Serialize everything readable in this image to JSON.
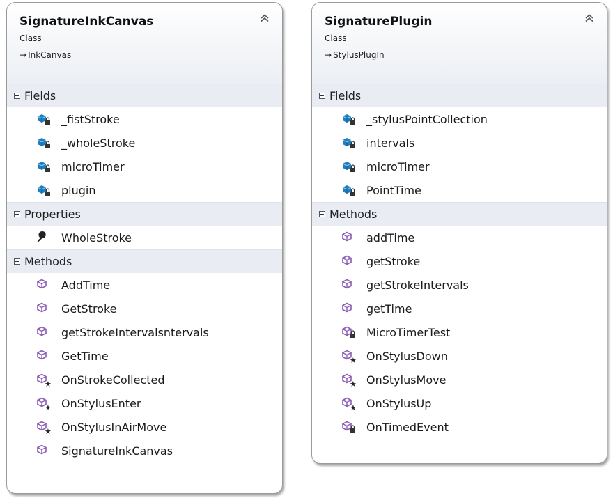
{
  "diagram": {
    "classes": [
      {
        "name": "SignatureInkCanvas",
        "stereotype": "Class",
        "base": "InkCanvas",
        "sections": [
          {
            "title": "Fields",
            "members": [
              {
                "name": "_fistStroke",
                "icon": "private-field-icon"
              },
              {
                "name": "_wholeStroke",
                "icon": "private-field-icon"
              },
              {
                "name": "microTimer",
                "icon": "private-field-icon"
              },
              {
                "name": "plugin",
                "icon": "private-field-icon"
              }
            ]
          },
          {
            "title": "Properties",
            "members": [
              {
                "name": "WholeStroke",
                "icon": "property-wrench-icon"
              }
            ]
          },
          {
            "title": "Methods",
            "members": [
              {
                "name": "AddTime",
                "icon": "public-method-icon"
              },
              {
                "name": "GetStroke",
                "icon": "public-method-icon"
              },
              {
                "name": "getStrokeIntervalsntervals",
                "icon": "public-method-icon"
              },
              {
                "name": "GetTime",
                "icon": "public-method-icon"
              },
              {
                "name": "OnStrokeCollected",
                "icon": "protected-method-icon"
              },
              {
                "name": "OnStylusEnter",
                "icon": "protected-method-icon"
              },
              {
                "name": "OnStylusInAirMove",
                "icon": "protected-method-icon"
              },
              {
                "name": "SignatureInkCanvas",
                "icon": "public-method-icon"
              }
            ]
          }
        ]
      },
      {
        "name": "SignaturePlugin",
        "stereotype": "Class",
        "base": "StylusPlugIn",
        "sections": [
          {
            "title": "Fields",
            "members": [
              {
                "name": "_stylusPointCollection",
                "icon": "private-field-icon"
              },
              {
                "name": "intervals",
                "icon": "private-field-icon"
              },
              {
                "name": "microTimer",
                "icon": "private-field-icon"
              },
              {
                "name": "PointTime",
                "icon": "private-field-icon"
              }
            ]
          },
          {
            "title": "Methods",
            "members": [
              {
                "name": "addTime",
                "icon": "public-method-icon"
              },
              {
                "name": "getStroke",
                "icon": "public-method-icon"
              },
              {
                "name": "getStrokeIntervals",
                "icon": "public-method-icon"
              },
              {
                "name": "getTime",
                "icon": "public-method-icon"
              },
              {
                "name": "MicroTimerTest",
                "icon": "private-method-icon"
              },
              {
                "name": "OnStylusDown",
                "icon": "protected-method-icon"
              },
              {
                "name": "OnStylusMove",
                "icon": "protected-method-icon"
              },
              {
                "name": "OnStylusUp",
                "icon": "protected-method-icon"
              },
              {
                "name": "OnTimedEvent",
                "icon": "private-method-icon"
              }
            ]
          }
        ]
      }
    ]
  },
  "colors": {
    "field_icon": "#1e7fc0",
    "method_icon": "#8a5bb7",
    "section_bg": "#e9edf3"
  }
}
